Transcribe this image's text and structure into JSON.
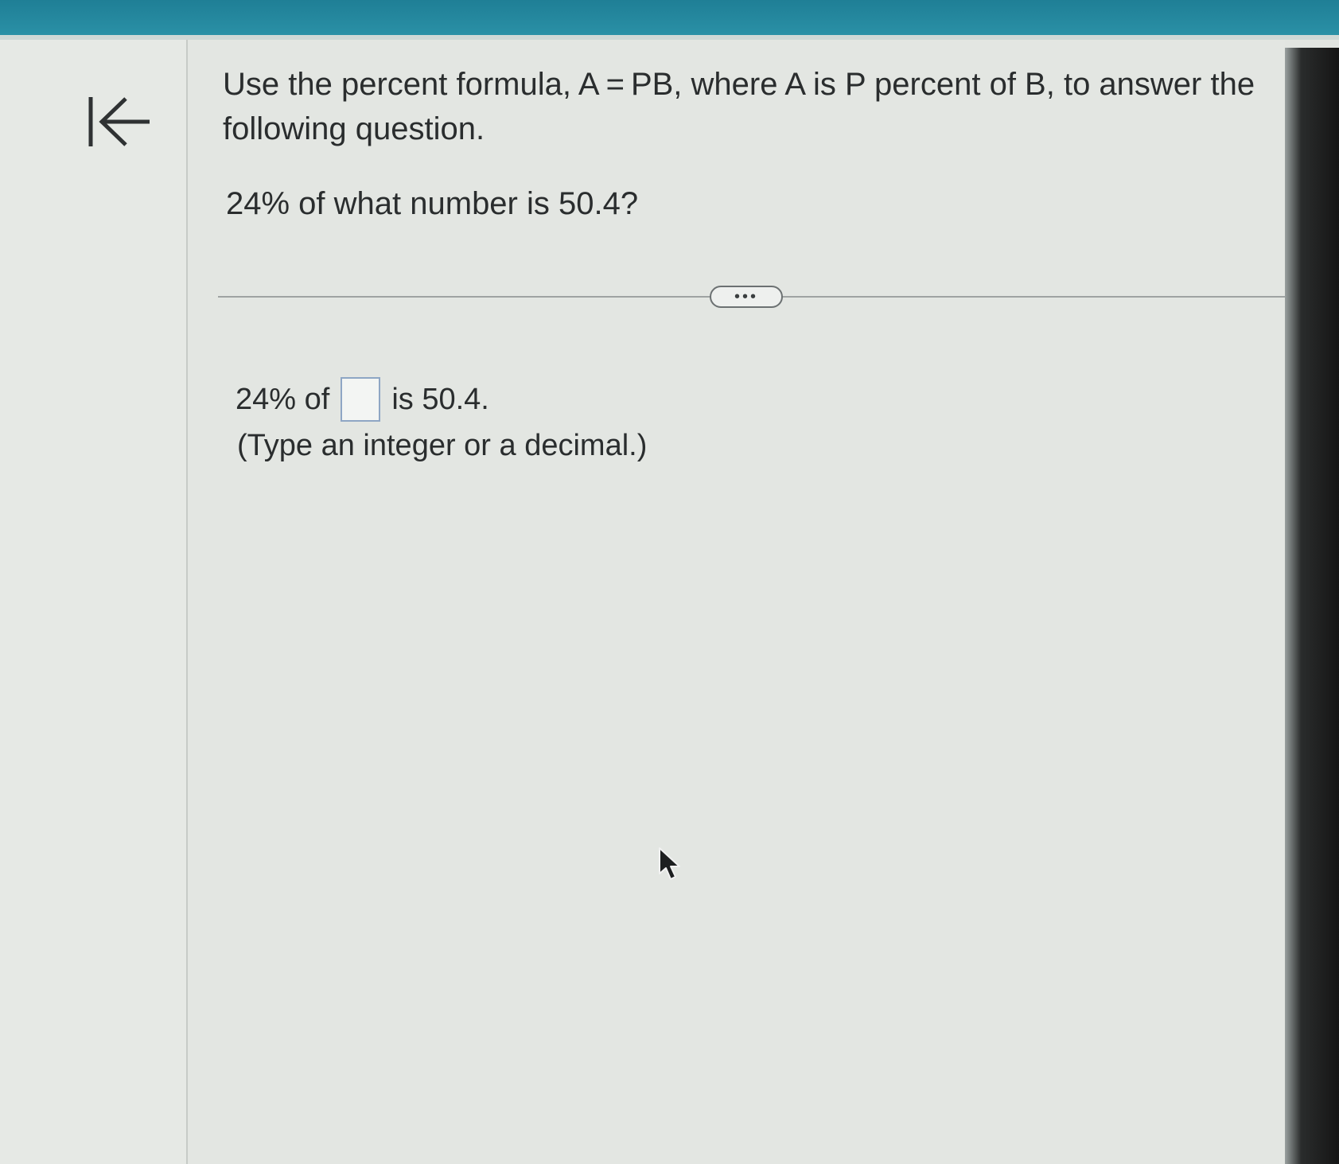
{
  "question": {
    "instruction": "Use the percent formula, A = PB, where A is P percent of B, to answer the following question.",
    "prompt": "24% of what number is 50.4?"
  },
  "answer": {
    "prefix": "24% of",
    "value": "",
    "suffix": "is 50.4.",
    "hint": "(Type an integer or a decimal.)"
  },
  "controls": {
    "more_label": "•••"
  },
  "icons": {
    "back": "back-to-start-icon",
    "cursor": "mouse-pointer-icon"
  },
  "colors": {
    "top_bar": "#2a90a6",
    "input_border": "#8ea6c4",
    "text": "#2a2d2e"
  }
}
